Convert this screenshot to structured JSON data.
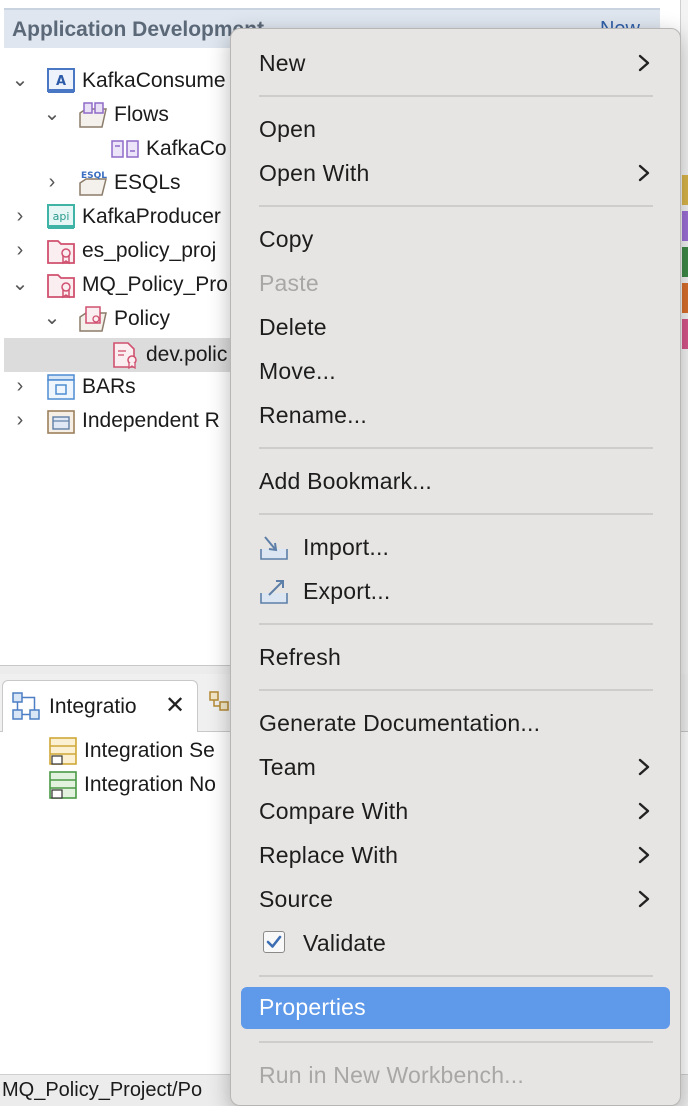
{
  "navigator": {
    "title": "Application Development",
    "new_link": "New",
    "tree": [
      {
        "label": "KafkaConsume",
        "level": 0,
        "expanded": true,
        "icon": "application-icon"
      },
      {
        "label": "Flows",
        "level": 1,
        "expanded": true,
        "icon": "flows-folder-icon"
      },
      {
        "label": "KafkaCo",
        "level": 2,
        "expanded": null,
        "icon": "message-flow-icon"
      },
      {
        "label": "ESQLs",
        "level": 1,
        "expanded": false,
        "icon": "esql-folder-icon"
      },
      {
        "label": "KafkaProducer",
        "level": 0,
        "expanded": false,
        "icon": "rest-api-icon"
      },
      {
        "label": "es_policy_proj",
        "level": 0,
        "expanded": false,
        "icon": "policy-project-icon"
      },
      {
        "label": "MQ_Policy_Pro",
        "level": 0,
        "expanded": true,
        "icon": "policy-project-icon"
      },
      {
        "label": "Policy",
        "level": 1,
        "expanded": true,
        "icon": "policy-folder-icon"
      },
      {
        "label": "dev.polic",
        "level": 2,
        "expanded": null,
        "icon": "policy-file-icon"
      },
      {
        "label": "BARs",
        "level": 0,
        "expanded": false,
        "icon": "bars-icon"
      },
      {
        "label": "Independent R",
        "level": 0,
        "expanded": false,
        "icon": "independent-resources-icon"
      }
    ]
  },
  "integration": {
    "tab_label": "Integratio",
    "close_glyph": "✕",
    "rows": [
      {
        "label": "Integration Se"
      },
      {
        "label": "Integration No"
      }
    ]
  },
  "status_bar": {
    "text": "MQ_Policy_Project/Po"
  },
  "context_menu": {
    "items": [
      {
        "label": "New",
        "submenu": true
      },
      {
        "label": "Open"
      },
      {
        "label": "Open With",
        "submenu": true
      },
      {
        "label": "Copy"
      },
      {
        "label": "Paste",
        "disabled": true
      },
      {
        "label": "Delete"
      },
      {
        "label": "Move..."
      },
      {
        "label": "Rename..."
      },
      {
        "label": "Add Bookmark..."
      },
      {
        "label": "Import...",
        "icon": "import-icon"
      },
      {
        "label": "Export...",
        "icon": "export-icon"
      },
      {
        "label": "Refresh"
      },
      {
        "label": "Generate Documentation..."
      },
      {
        "label": "Team",
        "submenu": true
      },
      {
        "label": "Compare With",
        "submenu": true
      },
      {
        "label": "Replace With",
        "submenu": true
      },
      {
        "label": "Source",
        "submenu": true
      },
      {
        "label": "Validate",
        "checked": true
      },
      {
        "label": "Properties",
        "highlighted": true
      },
      {
        "label": "Run in New Workbench...",
        "disabled": true
      }
    ]
  },
  "colors": {
    "menu_highlight": "#5f99ea",
    "menu_background": "#e7e5e3",
    "disabled_text": "#a9a7a5",
    "selection_row": "#dcdcdc"
  }
}
